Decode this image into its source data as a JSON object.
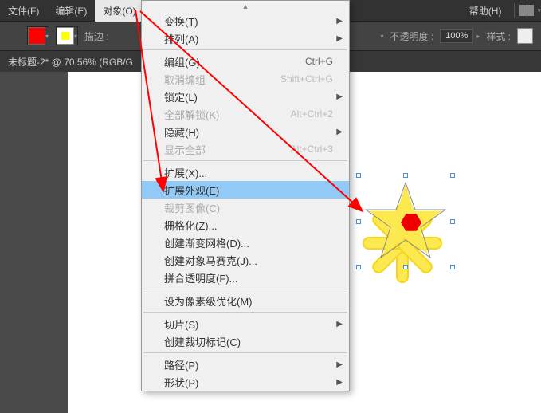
{
  "menubar": {
    "file": "文件(F)",
    "edit": "编辑(E)",
    "object": "对象(O)",
    "help": "帮助(H)"
  },
  "toolbar": {
    "stroke_label": "描边 :",
    "opacity_label": "不透明度 :",
    "opacity_value": "100%",
    "style_label": "样式 :"
  },
  "doctab": {
    "title": "未标题-2* @ 70.56% (RGB/G"
  },
  "menu": {
    "transform": "变换(T)",
    "arrange": "排列(A)",
    "group": "编组(G)",
    "group_sc": "Ctrl+G",
    "ungroup": "取消编组",
    "ungroup_sc": "Shift+Ctrl+G",
    "lock": "锁定(L)",
    "unlock_all": "全部解锁(K)",
    "unlock_all_sc": "Alt+Ctrl+2",
    "hide": "隐藏(H)",
    "show_all": "显示全部",
    "show_all_sc": "Alt+Ctrl+3",
    "expand": "扩展(X)...",
    "expand_appearance": "扩展外观(E)",
    "crop_image": "裁剪图像(C)",
    "rasterize": "栅格化(Z)...",
    "gradient_mesh": "创建渐变网格(D)...",
    "mosaic": "创建对象马赛克(J)...",
    "flatten": "拼合透明度(F)...",
    "pixel_perfect": "设为像素级优化(M)",
    "slice": "切片(S)",
    "trim_marks": "创建裁切标记(C)",
    "path": "路径(P)",
    "shape": "形状(P)"
  },
  "colors": {
    "swatch_fill": "#ff0000",
    "swatch_stroke": "#ffff00",
    "highlight": "#91c9f7",
    "arrow": "#ff0000"
  }
}
